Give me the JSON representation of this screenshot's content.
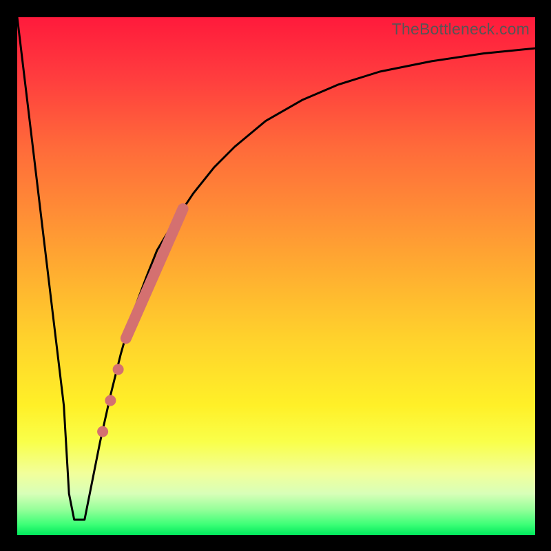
{
  "attribution": "TheBottleneck.com",
  "colors": {
    "curve_stroke": "#000000",
    "highlight_stroke": "#d47070",
    "highlight_dot": "#d47070"
  },
  "chart_data": {
    "type": "line",
    "title": "",
    "xlabel": "",
    "ylabel": "",
    "xlim": [
      0,
      100
    ],
    "ylim": [
      0,
      100
    ],
    "x": [
      0,
      3,
      6,
      9,
      10,
      11,
      12,
      13,
      14,
      16,
      18,
      20,
      22,
      25,
      27,
      30,
      34,
      38,
      42,
      48,
      55,
      62,
      70,
      80,
      90,
      100
    ],
    "y": [
      100,
      75,
      50,
      25,
      8,
      3,
      3,
      3,
      8,
      18,
      27,
      35,
      42,
      50,
      55,
      60,
      66,
      71,
      75,
      80,
      84,
      87,
      89.5,
      91.5,
      93,
      94
    ],
    "highlight_segment": {
      "x": [
        21,
        32
      ],
      "y": [
        38,
        63
      ]
    },
    "highlight_dots": [
      {
        "x": 19.5,
        "y": 32
      },
      {
        "x": 18.0,
        "y": 26
      },
      {
        "x": 16.5,
        "y": 20
      }
    ]
  }
}
